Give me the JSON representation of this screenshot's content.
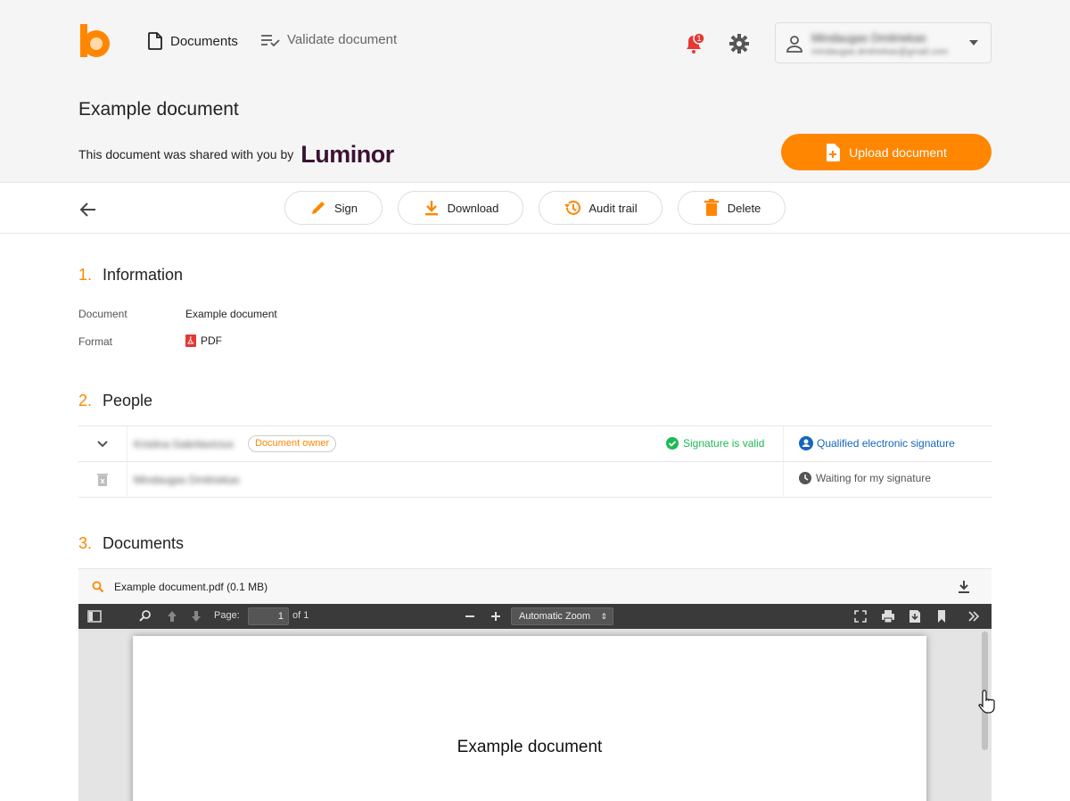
{
  "header": {
    "nav_documents": "Documents",
    "nav_validate": "Validate document",
    "notification_count": "1",
    "user_name": "Mindaugas Dmitriekas",
    "user_email": "mindaugas.dmitriekas@gmail.com"
  },
  "page": {
    "title": "Example document",
    "shared_text": "This document was shared with you by",
    "shared_brand": "Luminor",
    "upload_label": "Upload document"
  },
  "toolbar": {
    "sign": "Sign",
    "download": "Download",
    "audit": "Audit trail",
    "delete": "Delete"
  },
  "information": {
    "number": "1.",
    "title": "Information",
    "document_label": "Document",
    "document_value": "Example document",
    "format_label": "Format",
    "format_value": "PDF"
  },
  "people": {
    "number": "2.",
    "title": "People",
    "rows": [
      {
        "name": "Kristina Gabrilavicius",
        "badge": "Document owner",
        "status": "Signature is valid",
        "type": "Qualified electronic signature"
      },
      {
        "name": "Mindaugas Dmitriekas",
        "type": "Waiting for my signature"
      }
    ]
  },
  "documents": {
    "number": "3.",
    "title": "Documents",
    "file_name": "Example document.pdf (0.1 MB)",
    "page_label": "Page:",
    "page_value": "1",
    "page_of": "of 1",
    "zoom": "Automatic Zoom",
    "page_text": "Example document"
  },
  "colors": {
    "accent": "#ff8600",
    "valid": "#1db954",
    "link": "#1565c0",
    "brand": "#3b1233"
  }
}
